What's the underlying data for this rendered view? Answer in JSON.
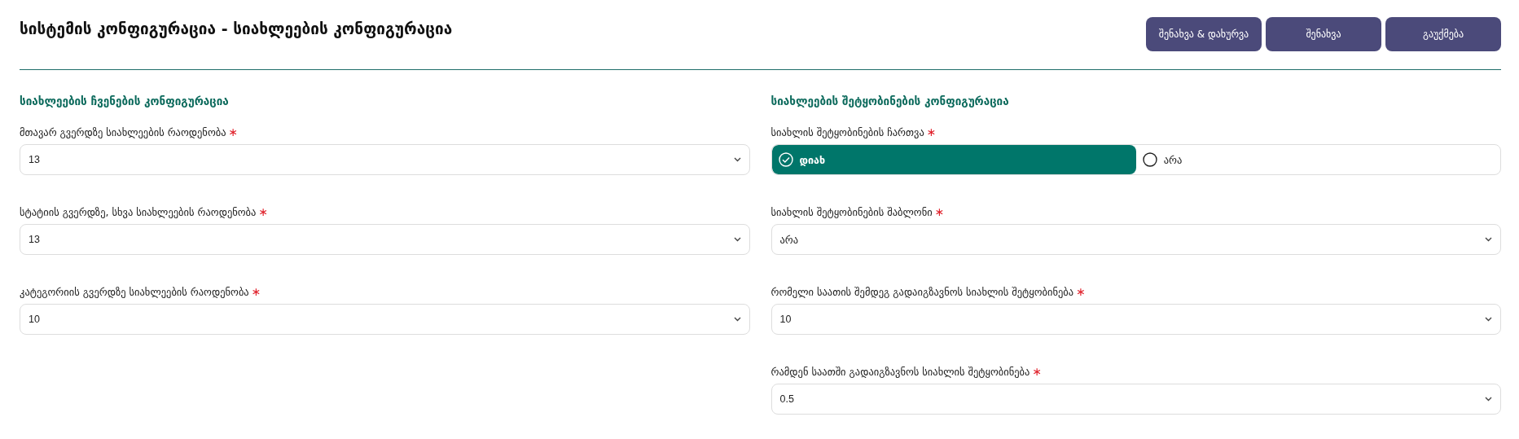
{
  "page_title": "სისტემის კონფიგურაცია - სიახლეების კონფიგურაცია",
  "buttons": [
    {
      "label": "შენახვა & დახურვა"
    },
    {
      "label": "შენახვა"
    },
    {
      "label": "გაუქმება"
    }
  ],
  "sections": [
    {
      "heading": "სიახლეების ჩვენების კონფიგურაცია",
      "fields": [
        {
          "kind": "select",
          "label": "მთავარ გვერდზე სიახლეების რაოდენობა",
          "required_mark": "∗",
          "value": "13"
        },
        {
          "kind": "select",
          "label": "სტატიის გვერდზე, სხვა სიახლეების რაოდენობა",
          "required_mark": "∗",
          "value": "13"
        },
        {
          "kind": "select",
          "label": "კატეგორიის გვერდზე სიახლეების რაოდენობა",
          "required_mark": "∗",
          "value": "10"
        }
      ]
    },
    {
      "heading": "სიახლეების შეტყობინების კონფიგურაცია",
      "fields": [
        {
          "kind": "radio",
          "label": "სიახლის შეტყობინების ჩართვა",
          "required_mark": "∗",
          "options": [
            {
              "label": "დიახ",
              "selected": true
            },
            {
              "label": "არა",
              "selected": false
            }
          ]
        },
        {
          "kind": "select",
          "label": "სიახლის შეტყობინების შაბლონი",
          "required_mark": "∗",
          "value": "არა"
        },
        {
          "kind": "select",
          "label": "რომელი საათის შემდეგ გადაიგზავნოს სიახლის შეტყობინება",
          "required_mark": "∗",
          "value": "10"
        },
        {
          "kind": "select",
          "label": "რამდენ საათში გადაიგზავნოს სიახლის შეტყობინება",
          "required_mark": "∗",
          "value": "0.5"
        }
      ]
    }
  ]
}
